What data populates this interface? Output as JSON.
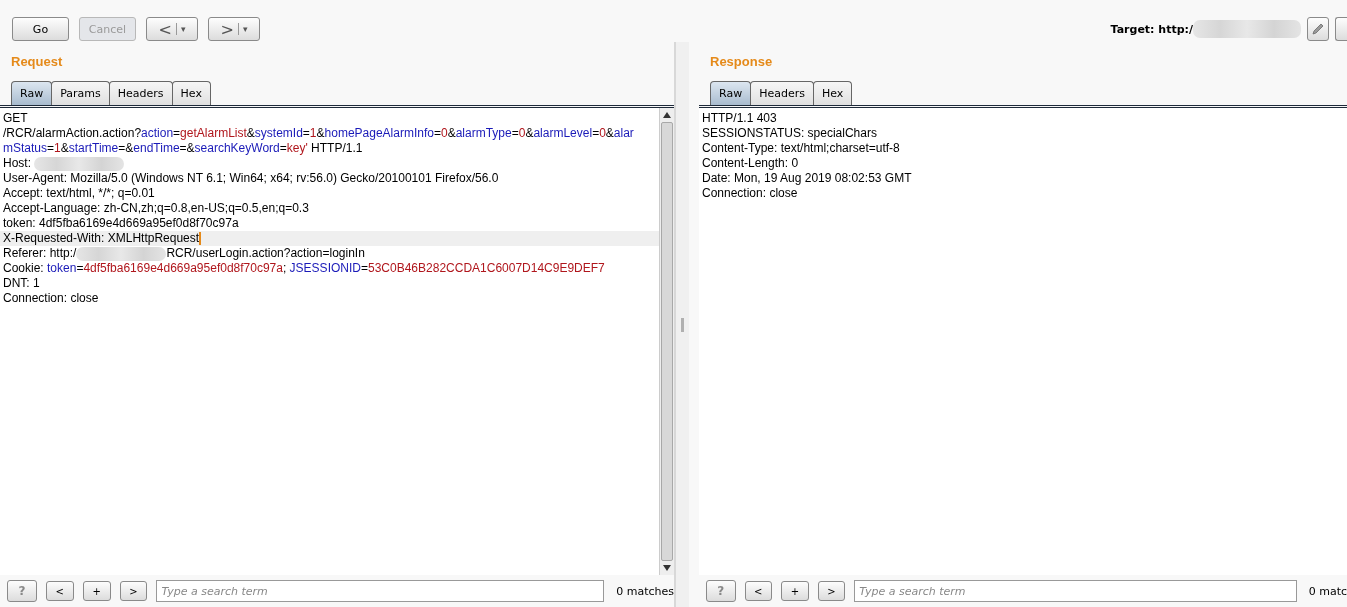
{
  "toolbar": {
    "buttons": [
      {
        "label": "Go",
        "disabled": false
      },
      {
        "label": "Cancel",
        "disabled": true
      }
    ],
    "nav": [
      {
        "label": "<",
        "caret": "▾"
      },
      {
        "label": ">",
        "caret": "▾"
      }
    ],
    "target_label": "Target: http:/"
  },
  "request": {
    "title": "Request",
    "tabs": [
      {
        "label": "Raw",
        "selected": true
      },
      {
        "label": "Params",
        "selected": false
      },
      {
        "label": "Headers",
        "selected": false
      },
      {
        "label": "Hex",
        "selected": false
      }
    ],
    "lines": [
      {
        "highlighted": false,
        "segments": [
          {
            "kind": "plain",
            "text": "GET"
          }
        ]
      },
      {
        "highlighted": false,
        "segments": [
          {
            "kind": "plain",
            "text": "/RCR/alarmAction.action?"
          },
          {
            "kind": "name",
            "text": "action"
          },
          {
            "kind": "plain",
            "text": "="
          },
          {
            "kind": "value",
            "text": "getAlarmList"
          },
          {
            "kind": "plain",
            "text": "&"
          },
          {
            "kind": "name",
            "text": "systemId"
          },
          {
            "kind": "plain",
            "text": "="
          },
          {
            "kind": "value",
            "text": "1"
          },
          {
            "kind": "plain",
            "text": "&"
          },
          {
            "kind": "name",
            "text": "homePageAlarmInfo"
          },
          {
            "kind": "plain",
            "text": "="
          },
          {
            "kind": "value",
            "text": "0"
          },
          {
            "kind": "plain",
            "text": "&"
          },
          {
            "kind": "name",
            "text": "alarmType"
          },
          {
            "kind": "plain",
            "text": "="
          },
          {
            "kind": "value",
            "text": "0"
          },
          {
            "kind": "plain",
            "text": "&"
          },
          {
            "kind": "name",
            "text": "alarmLevel"
          },
          {
            "kind": "plain",
            "text": "="
          },
          {
            "kind": "value",
            "text": "0"
          },
          {
            "kind": "plain",
            "text": "&"
          },
          {
            "kind": "name",
            "text": "alar"
          }
        ]
      },
      {
        "highlighted": false,
        "segments": [
          {
            "kind": "name",
            "text": "mStatus"
          },
          {
            "kind": "plain",
            "text": "="
          },
          {
            "kind": "value",
            "text": "1"
          },
          {
            "kind": "plain",
            "text": "&"
          },
          {
            "kind": "name",
            "text": "startTime"
          },
          {
            "kind": "plain",
            "text": "=&"
          },
          {
            "kind": "name",
            "text": "endTime"
          },
          {
            "kind": "plain",
            "text": "=&"
          },
          {
            "kind": "name",
            "text": "searchKeyWord"
          },
          {
            "kind": "plain",
            "text": "="
          },
          {
            "kind": "value",
            "text": "key'"
          },
          {
            "kind": "plain",
            "text": " HTTP/1.1"
          }
        ]
      },
      {
        "highlighted": false,
        "segments": [
          {
            "kind": "plain",
            "text": "Host: "
          },
          {
            "kind": "redacted"
          }
        ]
      },
      {
        "highlighted": false,
        "segments": [
          {
            "kind": "plain",
            "text": "User-Agent: Mozilla/5.0 (Windows NT 6.1; Win64; x64; rv:56.0) Gecko/20100101 Firefox/56.0"
          }
        ]
      },
      {
        "highlighted": false,
        "segments": [
          {
            "kind": "plain",
            "text": "Accept: text/html, */*; q=0.01"
          }
        ]
      },
      {
        "highlighted": false,
        "segments": [
          {
            "kind": "plain",
            "text": "Accept-Language: zh-CN,zh;q=0.8,en-US;q=0.5,en;q=0.3"
          }
        ]
      },
      {
        "highlighted": false,
        "segments": [
          {
            "kind": "plain",
            "text": "token: 4df5fba6169e4d669a95ef0d8f70c97a"
          }
        ]
      },
      {
        "highlighted": true,
        "segments": [
          {
            "kind": "plain",
            "text": "X-Requested-With: XMLHttpRequest"
          }
        ]
      },
      {
        "highlighted": false,
        "segments": [
          {
            "kind": "plain",
            "text": "Referer: http:/"
          },
          {
            "kind": "redacted"
          },
          {
            "kind": "plain",
            "text": "RCR/userLogin.action?action=loginIn"
          }
        ]
      },
      {
        "highlighted": false,
        "segments": [
          {
            "kind": "plain",
            "text": "Cookie: "
          },
          {
            "kind": "name",
            "text": "token"
          },
          {
            "kind": "plain",
            "text": "="
          },
          {
            "kind": "value",
            "text": "4df5fba6169e4d669a95ef0d8f70c97a"
          },
          {
            "kind": "plain",
            "text": "; "
          },
          {
            "kind": "name",
            "text": "JSESSIONID"
          },
          {
            "kind": "plain",
            "text": "="
          },
          {
            "kind": "value",
            "text": "53C0B46B282CCDA1C6007D14C9E9DEF7"
          }
        ]
      },
      {
        "highlighted": false,
        "segments": [
          {
            "kind": "plain",
            "text": "DNT: 1"
          }
        ]
      },
      {
        "highlighted": false,
        "segments": [
          {
            "kind": "plain",
            "text": "Connection: close"
          }
        ]
      }
    ],
    "search": {
      "help": "?",
      "prev": "<",
      "add": "+",
      "next": ">",
      "placeholder": "Type a search term",
      "matches": "0 matches"
    }
  },
  "response": {
    "title": "Response",
    "tabs": [
      {
        "label": "Raw",
        "selected": true
      },
      {
        "label": "Headers",
        "selected": false
      },
      {
        "label": "Hex",
        "selected": false
      }
    ],
    "lines": [
      {
        "highlighted": false,
        "segments": [
          {
            "kind": "plain",
            "text": "HTTP/1.1 403"
          }
        ]
      },
      {
        "highlighted": false,
        "segments": [
          {
            "kind": "plain",
            "text": "SESSIONSTATUS: specialChars"
          }
        ]
      },
      {
        "highlighted": false,
        "segments": [
          {
            "kind": "plain",
            "text": "Content-Type: text/html;charset=utf-8"
          }
        ]
      },
      {
        "highlighted": false,
        "segments": [
          {
            "kind": "plain",
            "text": "Content-Length: 0"
          }
        ]
      },
      {
        "highlighted": false,
        "segments": [
          {
            "kind": "plain",
            "text": "Date: Mon, 19 Aug 2019 08:02:53 GMT"
          }
        ]
      },
      {
        "highlighted": false,
        "segments": [
          {
            "kind": "plain",
            "text": "Connection: close"
          }
        ]
      }
    ],
    "search": {
      "help": "?",
      "prev": "<",
      "add": "+",
      "next": ">",
      "placeholder": "Type a search term",
      "matches": "0 matc"
    }
  }
}
